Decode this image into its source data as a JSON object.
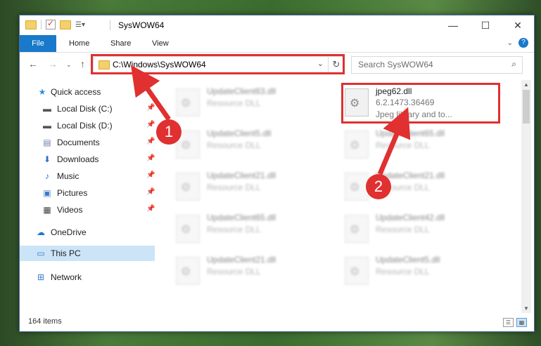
{
  "window": {
    "title": "SysWOW64"
  },
  "ribbon": {
    "tabs": [
      "File",
      "Home",
      "Share",
      "View"
    ]
  },
  "address": {
    "path": "C:\\Windows\\SysWOW64"
  },
  "search": {
    "placeholder": "Search SysWOW64"
  },
  "sidebar": {
    "items": [
      {
        "label": "Quick access",
        "icon": "star-icon"
      },
      {
        "label": "Local Disk (C:)",
        "icon": "drive-icon"
      },
      {
        "label": "Local Disk (D:)",
        "icon": "drive-icon"
      },
      {
        "label": "Documents",
        "icon": "documents-icon"
      },
      {
        "label": "Downloads",
        "icon": "download-icon"
      },
      {
        "label": "Music",
        "icon": "music-icon"
      },
      {
        "label": "Pictures",
        "icon": "pictures-icon"
      },
      {
        "label": "Videos",
        "icon": "videos-icon"
      },
      {
        "label": "OneDrive",
        "icon": "cloud-icon"
      },
      {
        "label": "This PC",
        "icon": "computer-icon"
      },
      {
        "label": "Network",
        "icon": "network-icon"
      }
    ]
  },
  "files": {
    "highlighted": {
      "name": "jpeg62.dll",
      "version": "6.2.1473.36469",
      "description": "Jpeg library and to..."
    },
    "left": [
      {
        "name": "UpdateClient63.dll",
        "type": "Resource DLL"
      },
      {
        "name": "UpdateClient5.dll",
        "type": "Resource DLL"
      },
      {
        "name": "UpdateClient21.dll",
        "type": "Resource DLL"
      },
      {
        "name": "UpdateClient65.dll",
        "type": "Resource DLL"
      },
      {
        "name": "UpdateClient21.dll",
        "type": "Resource DLL"
      }
    ],
    "right": [
      {
        "name": "UpdateClient65.dll",
        "type": "Resource DLL"
      },
      {
        "name": "UpdateClient21.dll",
        "type": "Resource DLL"
      },
      {
        "name": "UpdateClient42.dll",
        "type": "Resource DLL"
      },
      {
        "name": "UpdateClient5.dll",
        "type": "Resource DLL"
      }
    ]
  },
  "status": {
    "count": "164 items"
  },
  "callouts": [
    "1",
    "2"
  ],
  "colors": {
    "accent": "#1979ca",
    "highlight": "#e03030",
    "selected": "#cce4f7"
  }
}
